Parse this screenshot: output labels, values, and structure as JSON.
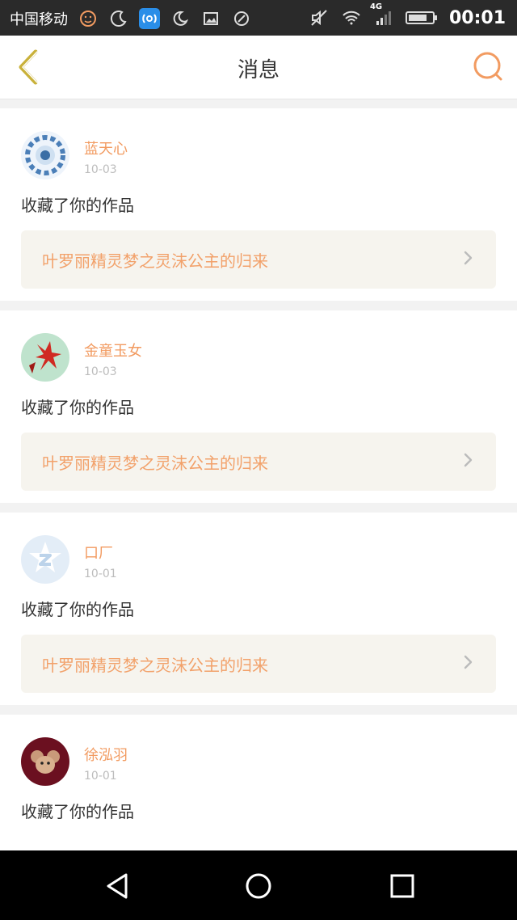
{
  "status_bar": {
    "carrier": "中国移动",
    "network": "4G",
    "time": "00:01"
  },
  "nav": {
    "title": "消息"
  },
  "messages": [
    {
      "username": "蓝天心",
      "date": "10-03",
      "action": "收藏了你的作品",
      "work_title": "叶罗丽精灵梦之灵沫公主的归来"
    },
    {
      "username": "金童玉女",
      "date": "10-03",
      "action": "收藏了你的作品",
      "work_title": "叶罗丽精灵梦之灵沫公主的归来"
    },
    {
      "username": "口厂",
      "date": "10-01",
      "action": "收藏了你的作品",
      "work_title": "叶罗丽精灵梦之灵沫公主的归来"
    },
    {
      "username": "徐泓羽",
      "date": "10-01",
      "action": "收藏了你的作品",
      "work_title": ""
    }
  ],
  "colors": {
    "accent": "#f29b61",
    "work_bg": "#f6f4ee"
  }
}
